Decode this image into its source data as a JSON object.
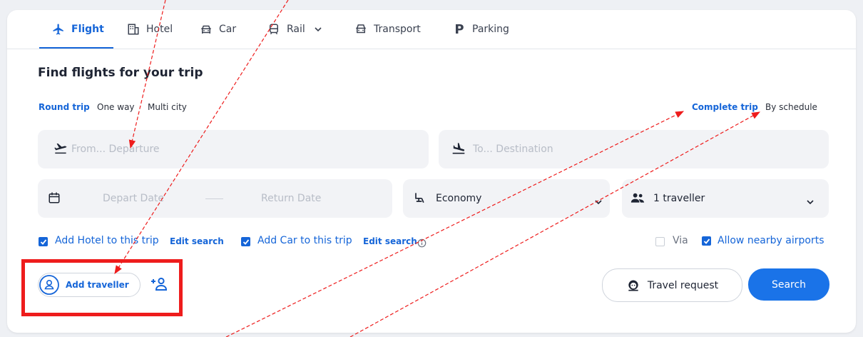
{
  "tabs": [
    {
      "label": "Flight",
      "icon": "plane-icon",
      "active": true
    },
    {
      "label": "Hotel",
      "icon": "building-icon"
    },
    {
      "label": "Car",
      "icon": "car-icon"
    },
    {
      "label": "Rail",
      "icon": "train-icon"
    },
    {
      "label": "Transport",
      "icon": "bus-icon"
    },
    {
      "label": "Parking",
      "icon": "parking-icon"
    }
  ],
  "heading": "Find flights for your trip",
  "trip_types": [
    "Round trip",
    "One way",
    "Multi city"
  ],
  "trip_modes": [
    "Complete trip",
    "By schedule"
  ],
  "from_placeholder": "From... Departure",
  "to_placeholder": "To... Destination",
  "depart_placeholder": "Depart Date",
  "return_placeholder": "Return Date",
  "cabin_class": "Economy",
  "travellers": "1 traveller",
  "add_hotel_label": "Add Hotel to this trip",
  "add_car_label": "Add Car to this trip",
  "edit_search": "Edit search",
  "via_label": "Via",
  "nearby_label": "Allow nearby airports",
  "add_traveller_label": "Add traveller",
  "travel_request_label": "Travel request",
  "search_label": "Search",
  "colors": {
    "accent": "#1565d8",
    "primary_button": "#1a73e8",
    "annotation": "#ee1c1c"
  }
}
